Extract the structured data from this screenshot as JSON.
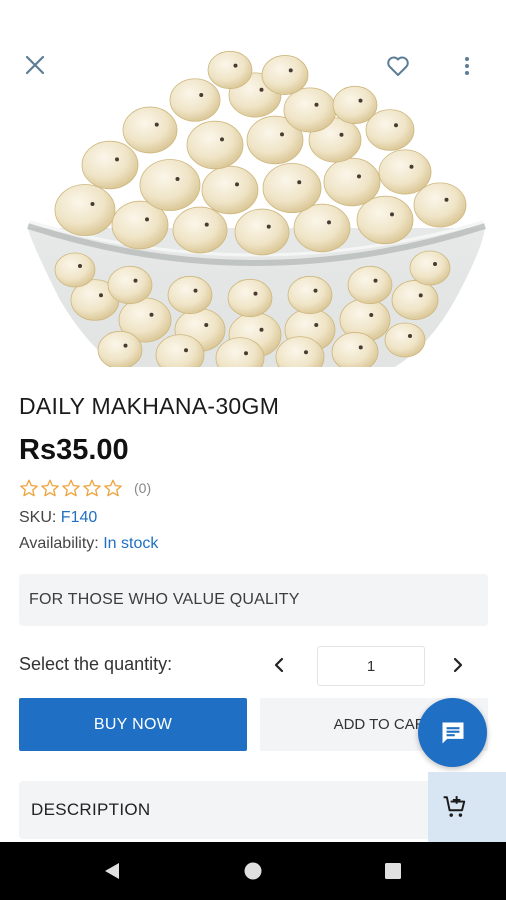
{
  "product": {
    "title": "DAILY MAKHANA-30GM",
    "price": "Rs35.00",
    "rating_stars": 0,
    "rating_count": "(0)",
    "sku_label": "SKU:",
    "sku_value": "F140",
    "availability_label": "Availability:",
    "availability_value": "In stock",
    "tagline": "FOR THOSE WHO VALUE QUALITY"
  },
  "quantity": {
    "label": "Select the quantity:",
    "value": "1"
  },
  "actions": {
    "buy_now": "BUY NOW",
    "add_to_cart": "ADD TO CART"
  },
  "sections": {
    "description": "DESCRIPTION"
  },
  "icons": {
    "close": "close-icon",
    "favorite": "heart-outline-icon",
    "more": "more-vert-icon",
    "chat": "chat-icon",
    "cart": "add-shopping-cart-icon"
  },
  "colors": {
    "accent": "#1f6fc4",
    "star": "#f0a23a",
    "panel": "#f2f4f6"
  }
}
